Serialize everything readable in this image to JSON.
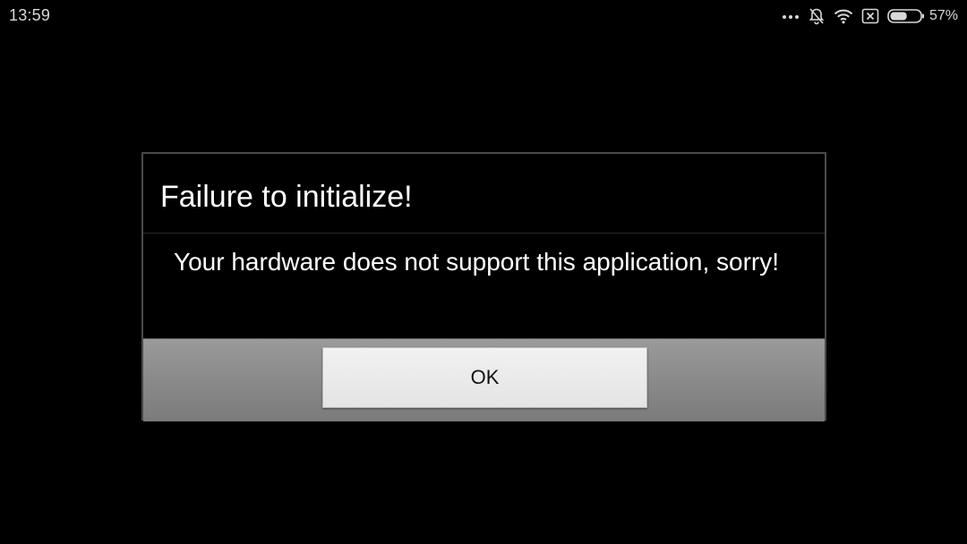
{
  "status_bar": {
    "time": "13:59",
    "icons": [
      "more-dots-icon",
      "notifications-off-icon",
      "wifi-icon",
      "no-sim-icon",
      "battery-icon"
    ],
    "battery_percent": "57%",
    "battery_level": 0.57
  },
  "dialog": {
    "title": "Failure to initialize!",
    "message": "Your hardware does not support this application, sorry!",
    "ok_label": "OK"
  },
  "colors": {
    "background": "#000000",
    "dialog_border": "#4a4a4a",
    "footer": "#8a8a8a",
    "button": "#e8e8e8",
    "text": "#ffffff"
  }
}
